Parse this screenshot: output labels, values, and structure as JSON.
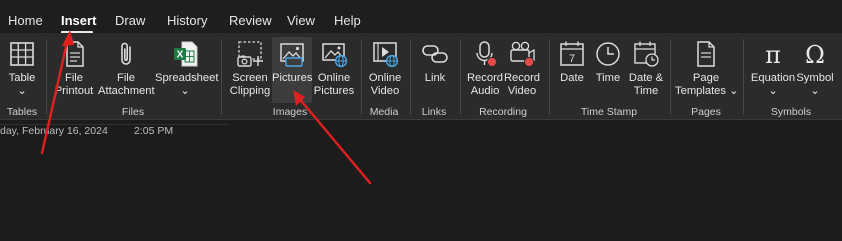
{
  "tabs": [
    "Home",
    "Insert",
    "Draw",
    "History",
    "Review",
    "View",
    "Help"
  ],
  "active_tab": "Insert",
  "groups": {
    "tables": "Tables",
    "files": "Files",
    "images": "Images",
    "media": "Media",
    "links": "Links",
    "recording": "Recording",
    "time_stamp": "Time Stamp",
    "pages": "Pages",
    "symbols": "Symbols"
  },
  "buttons": {
    "table": [
      "Table",
      "⌄"
    ],
    "file_printout": [
      "File",
      "Printout"
    ],
    "file_attachment": [
      "File",
      "Attachment"
    ],
    "spreadsheet": [
      "Spreadsheet",
      "⌄"
    ],
    "screen_clipping": [
      "Screen",
      "Clipping"
    ],
    "pictures": [
      "Pictures",
      ""
    ],
    "online_pictures": [
      "Online",
      "Pictures"
    ],
    "online_video": [
      "Online",
      "Video"
    ],
    "link": [
      "Link",
      ""
    ],
    "record_audio": [
      "Record",
      "Audio"
    ],
    "record_video": [
      "Record",
      "Video"
    ],
    "date": [
      "Date",
      ""
    ],
    "time": [
      "Time",
      ""
    ],
    "date_time": [
      "Date &",
      "Time"
    ],
    "page_templates": [
      "Page",
      "Templates ⌄"
    ],
    "equation": [
      "Equation",
      "⌄"
    ],
    "symbol": [
      "Symbol",
      "⌄"
    ]
  },
  "page_date": "day, February 16, 2024",
  "page_time": "2:05 PM",
  "colors": {
    "background": "#1c1c1c",
    "ribbon": "#2b2b2b",
    "annotation_arrow": "#e0201e",
    "excel_green": "#1e7a45",
    "record_red": "#e24a4a"
  }
}
